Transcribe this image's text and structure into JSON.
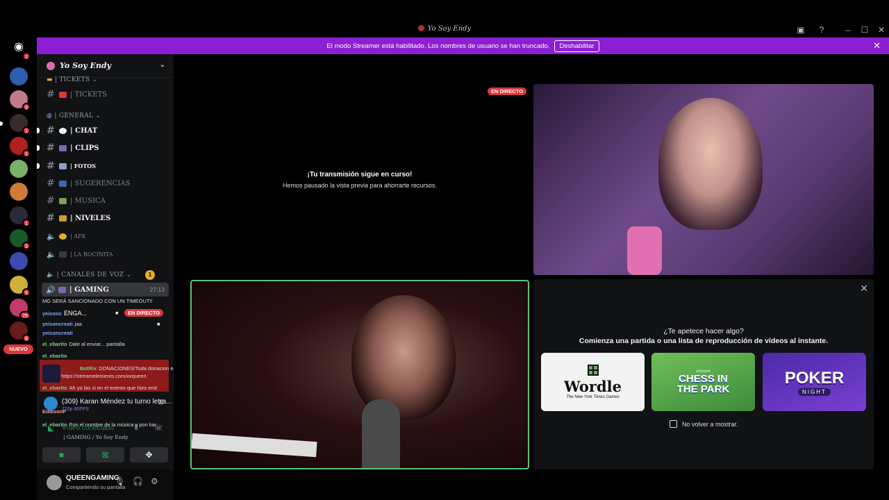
{
  "window": {
    "title": "Yo Soy Endy"
  },
  "banner": {
    "text": "El modo Streamer está habilitado. Los nombres de usuario se han truncado.",
    "button": "Deshabilitar"
  },
  "servers": {
    "badges": [
      "1",
      "5",
      "1",
      "1",
      "1",
      "3",
      "5",
      "75",
      "8"
    ],
    "new_label": "NUEVO"
  },
  "server": {
    "name": "Yo Soy Endy"
  },
  "categories": {
    "tickets": "| TICKETS",
    "general": "| GENERAL",
    "voice": "| CANALES DE VOZ",
    "voice_badge": "1"
  },
  "channels": [
    {
      "name": "| TICKETS"
    },
    {
      "name": "| CHAT"
    },
    {
      "name": "| CLIPS"
    },
    {
      "name": "| FOTOS"
    },
    {
      "name": "| SUGERENCIAS"
    },
    {
      "name": "| MUSICA"
    },
    {
      "name": "| NIVELES"
    },
    {
      "name": "| AFK"
    },
    {
      "name": "| LA BOCINITA"
    }
  ],
  "voice_channel": {
    "name": "| GAMING",
    "time": "27:13"
  },
  "chat": {
    "l1": "MG SERÁ SANCIONADO CON UN TIMEOUT!!",
    "l2_user": "yeisonc",
    "l2_text": "ENGA...",
    "live": "EN DIRECTO",
    "l3_user": "yeisoncreati",
    "l3_text": "jaa",
    "l4_user": "yeisoncreati",
    "l4_text": "",
    "l5_user": "el_ebarito",
    "l5_text": "Dale al enviar... pantalla",
    "l6_user": "el_ebarito",
    "l6_text": "",
    "l7_user": "BotRix",
    "l7_text": "DONACIONES!Toda donacion e",
    "l8_text": "camara https://streamelements.com/xxqueen",
    "l9_user": "el_ebarito",
    "l9_text": "Ah yo las vi en el evento que hizo end",
    "l10_user": "EddisonF",
    "l10_text": "",
    "l11_user": "el_ebarito",
    "l11_text": "Pon el nombre de la música y pon kar"
  },
  "stream_card": {
    "title": "(309) Karan Méndez tu turno letra...",
    "quality": "720p 60FPS"
  },
  "voice_status": {
    "label": "Vídeo conectado",
    "sub": "| GAMING / Yo Soy Endy"
  },
  "user": {
    "name": "QUEENGAMING",
    "status": "Compartiendo su pantalla"
  },
  "stage": {
    "live": "EN DIRECTO",
    "paused_title": "¡Tu transmisión sigue en curso!",
    "paused_sub": "Hemos pausado la vista previa para ahorrarte recursos."
  },
  "activity": {
    "title": "¿Te apetece hacer algo?",
    "subtitle": "Comienza una partida o una lista de reproducción de vídeos al instante.",
    "games": [
      {
        "name": "Wordle",
        "sub": "The New York Times Games"
      },
      {
        "name": "CHESS IN THE PARK",
        "sub": "Discord"
      },
      {
        "name": "POKER",
        "sub": "NIGHT"
      }
    ],
    "checkbox_label": "No volver a mostrar."
  }
}
